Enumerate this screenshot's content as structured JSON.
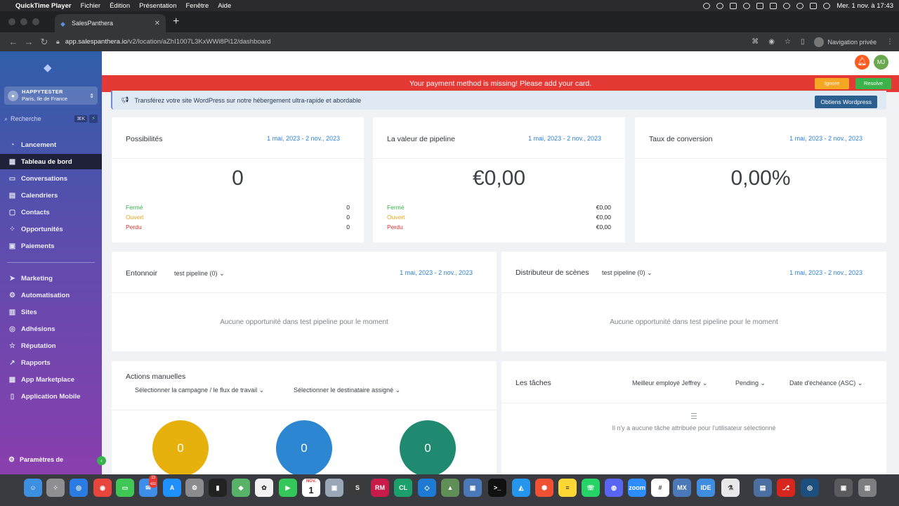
{
  "menubar": {
    "apple": "",
    "app": "QuickTime Player",
    "items": [
      "Fichier",
      "Édition",
      "Présentation",
      "Fenêtre",
      "Aide"
    ],
    "clock": "Mer. 1 nov. à 17:43"
  },
  "browser": {
    "tab_title": "SalesPanthera",
    "url_host": "app.salespanthera.io",
    "url_path": "/v2/location/aZhI1007L3KxWWi8Pi12/dashboard",
    "private_label": "Navigation privée"
  },
  "sidebar": {
    "account_name": "HAPPYTESTER",
    "account_location": "Paris, Ile de France",
    "search_placeholder": "Recherche",
    "search_kbd": "⌘K",
    "items": [
      {
        "label": "Lancement",
        "icon": "rocket-icon",
        "glyph": "◔"
      },
      {
        "label": "Tableau de bord",
        "icon": "dashboard-icon",
        "glyph": "▦"
      },
      {
        "label": "Conversations",
        "icon": "chat-icon",
        "glyph": "▭"
      },
      {
        "label": "Calendriers",
        "icon": "calendar-icon",
        "glyph": "▤"
      },
      {
        "label": "Contacts",
        "icon": "contacts-icon",
        "glyph": "▢"
      },
      {
        "label": "Opportunités",
        "icon": "opportunities-icon",
        "glyph": "⁘"
      },
      {
        "label": "Paiements",
        "icon": "payments-icon",
        "glyph": "▣"
      },
      {
        "label": "Marketing",
        "icon": "send-icon",
        "glyph": "➤"
      },
      {
        "label": "Automatisation",
        "icon": "automation-icon",
        "glyph": "⚙"
      },
      {
        "label": "Sites",
        "icon": "sites-icon",
        "glyph": "▥"
      },
      {
        "label": "Adhésions",
        "icon": "membership-icon",
        "glyph": "◎"
      },
      {
        "label": "Réputation",
        "icon": "star-icon",
        "glyph": "☆"
      },
      {
        "label": "Rapports",
        "icon": "chart-icon",
        "glyph": "↗"
      },
      {
        "label": "App Marketplace",
        "icon": "marketplace-icon",
        "glyph": "▦"
      },
      {
        "label": "Application Mobile",
        "icon": "mobile-icon",
        "glyph": "▯"
      }
    ],
    "settings": "Paramètres de"
  },
  "topbar": {
    "avatar": "MJ"
  },
  "alert": {
    "text": "Your payment method is missing! Please add your card.",
    "ignore": "Ignore",
    "resolve": "Resolve"
  },
  "wp_banner": {
    "text": "Transférez votre site WordPress sur notre hébergement ultra-rapide et abordable",
    "button": "Obtiens Wordpress"
  },
  "date_range": "1 mai, 2023 - 2 nov., 2023",
  "stats": [
    {
      "title": "Possibilités",
      "value": "0",
      "ferme": "0",
      "ouvert": "0",
      "perdu": "0"
    },
    {
      "title": "La valeur de pipeline",
      "value": "€0,00",
      "ferme": "€0,00",
      "ouvert": "€0,00",
      "perdu": "€0,00"
    },
    {
      "title": "Taux de conversion",
      "value": "0,00%"
    }
  ],
  "status_labels": {
    "ferme": "Fermé",
    "ouvert": "Ouvert",
    "perdu": "Perdu"
  },
  "funnel": {
    "title": "Entonnoir",
    "pipeline": "test pipeline (0)",
    "empty": "Aucune opportunité dans test pipeline pour le moment"
  },
  "stages": {
    "title": "Distributeur de scènes",
    "pipeline": "test pipeline (0)",
    "empty": "Aucune opportunité dans test pipeline pour le moment"
  },
  "manual": {
    "title": "Actions manuelles",
    "campaign": "Sélectionner la campagne / le flux de travail",
    "assignee": "Sélectionner le destinataire assigné",
    "counts": [
      "0",
      "0",
      "0"
    ],
    "colors": [
      "#e6b10c",
      "#2c86d2",
      "#1f8a6f"
    ]
  },
  "tasks": {
    "title": "Les tâches",
    "filter_user": "Meilleur employé Jeffrey",
    "filter_status": "Pending",
    "filter_sort": "Date d'échéance (ASC)",
    "empty": "Il n'y a aucune tâche attribuée pour l'utilisateur sélectionné"
  },
  "dock": {
    "badge_mail": "13 431",
    "calendar_month": "NOV.",
    "calendar_day": "1",
    "apps": [
      {
        "name": "finder",
        "color": "#3d8fe0",
        "glyph": "☺"
      },
      {
        "name": "launchpad",
        "color": "#8e8e93",
        "glyph": "⁘"
      },
      {
        "name": "safari",
        "color": "#2a7be4",
        "glyph": "◎"
      },
      {
        "name": "chrome",
        "color": "#e8453c",
        "glyph": "◉"
      },
      {
        "name": "messages",
        "color": "#3ec755",
        "glyph": "▭"
      },
      {
        "name": "mail",
        "color": "#3e8de8",
        "glyph": "✉"
      },
      {
        "name": "app-store",
        "color": "#1e90ff",
        "glyph": "A"
      },
      {
        "name": "system-settings",
        "color": "#8a8a8f",
        "glyph": "⚙"
      },
      {
        "name": "activity-monitor",
        "color": "#222",
        "glyph": "▮"
      },
      {
        "name": "maps",
        "color": "#58b368",
        "glyph": "◆"
      },
      {
        "name": "photos",
        "color": "#f2f2f2",
        "glyph": "✿"
      },
      {
        "name": "facetime",
        "color": "#34c759",
        "glyph": "▶"
      },
      {
        "name": "calendar",
        "color": "#ffffff",
        "glyph": "1"
      },
      {
        "name": "keychain",
        "color": "#9aa7b6",
        "glyph": "▣"
      },
      {
        "name": "sublime",
        "color": "#3b3b3b",
        "glyph": "S"
      },
      {
        "name": "rubymine",
        "color": "#c81b4a",
        "glyph": "RM"
      },
      {
        "name": "clion",
        "color": "#1b9f6b",
        "glyph": "CL"
      },
      {
        "name": "vscode",
        "color": "#1e7bd4",
        "glyph": "◇"
      },
      {
        "name": "android-studio",
        "color": "#5f8f56",
        "glyph": "▲"
      },
      {
        "name": "virtualbox",
        "color": "#4a78b8",
        "glyph": "▣"
      },
      {
        "name": "terminal",
        "color": "#111",
        "glyph": ">_"
      },
      {
        "name": "docker",
        "color": "#2496ed",
        "glyph": "◭"
      },
      {
        "name": "git-tool",
        "color": "#f05033",
        "glyph": "⬢"
      },
      {
        "name": "notes",
        "color": "#fdd835",
        "glyph": "≡"
      },
      {
        "name": "whatsapp",
        "color": "#25d366",
        "glyph": "☏"
      },
      {
        "name": "discord",
        "color": "#5865f2",
        "glyph": "◍"
      },
      {
        "name": "zoom",
        "color": "#2d8cff",
        "glyph": "zoom"
      },
      {
        "name": "slack",
        "color": "#ffffff",
        "glyph": "#"
      },
      {
        "name": "mx-app",
        "color": "#4a78b8",
        "glyph": "MX"
      },
      {
        "name": "ide-app",
        "color": "#3f8de0",
        "glyph": "IDE"
      },
      {
        "name": "instruments",
        "color": "#e8e8ea",
        "glyph": "⚗"
      },
      {
        "name": "preview",
        "color": "#4b6fa0",
        "glyph": "▤"
      },
      {
        "name": "acrobat",
        "color": "#d7261e",
        "glyph": "⎇"
      },
      {
        "name": "quicktime",
        "color": "#1c4f7d",
        "glyph": "◎"
      },
      {
        "name": "screenshot",
        "color": "#5a5a5f",
        "glyph": "▣"
      },
      {
        "name": "trash",
        "color": "#7d7d82",
        "glyph": "▥"
      }
    ]
  }
}
